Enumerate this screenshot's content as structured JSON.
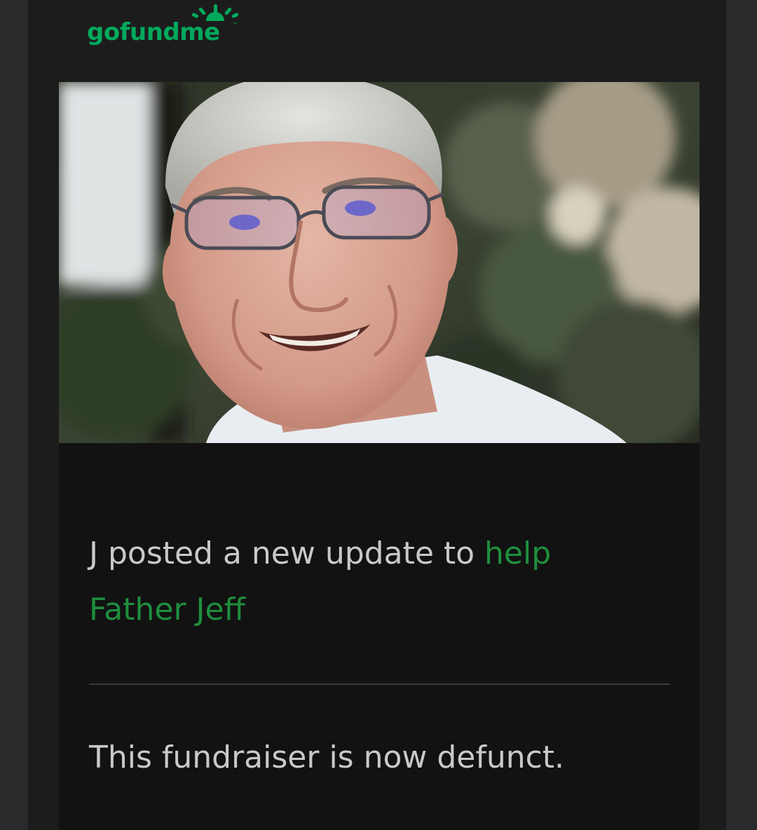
{
  "brand": {
    "name": "gofundme",
    "trademark": "™",
    "color": "#02a95c"
  },
  "hero_image": {
    "icon": "profile-photo"
  },
  "update": {
    "text_before_link": "J posted a new update to ",
    "link_text": "help Father Jeff",
    "link_color": "#1f8e3d"
  },
  "status_message": "This fundraiser is now defunct.",
  "colors": {
    "background": "#1c1c1c",
    "card": "#121212",
    "text": "#c9c9c9"
  }
}
